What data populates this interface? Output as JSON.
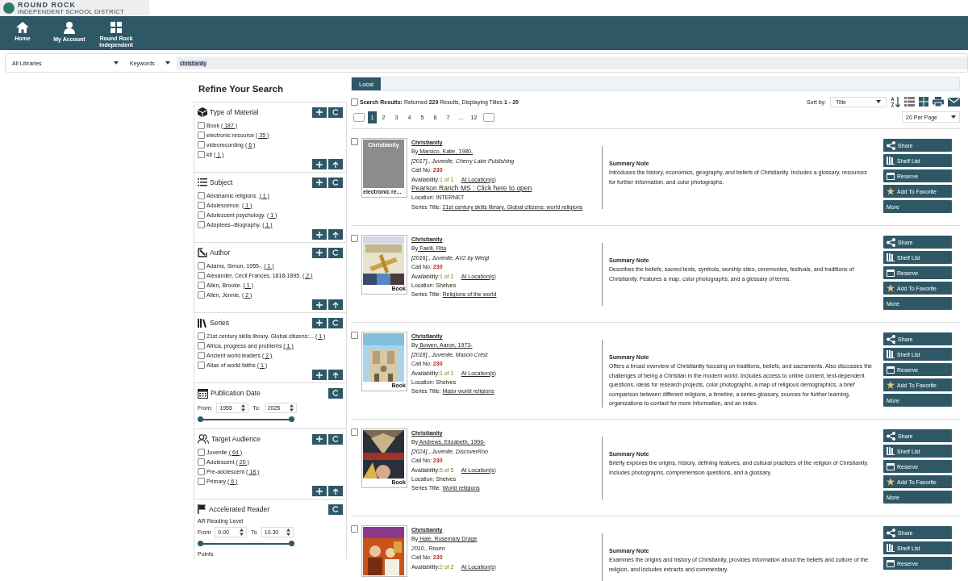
{
  "logo": {
    "name": "ROUND ROCK",
    "subtitle": "INDEPENDENT SCHOOL DISTRICT"
  },
  "nav": [
    {
      "kind": "home",
      "label": "Home"
    },
    {
      "kind": "account",
      "label": "My Account"
    },
    {
      "kind": "apps",
      "label": "Round Rock Independent"
    }
  ],
  "search": {
    "library": "All Libraries",
    "field": "Keywords",
    "value": "christianity"
  },
  "refine_title": "Refine Your Search",
  "facets": [
    {
      "kind": "checklist",
      "title": "Type of Material",
      "items": [
        {
          "label": "Book",
          "count": "( 187 )",
          "checked": false
        },
        {
          "label": "electronic resource",
          "count": "( 35 )",
          "checked": false
        },
        {
          "label": "videorecording",
          "count": "( 6 )",
          "checked": false
        },
        {
          "label": "kit",
          "count": "( 1 )",
          "checked": false
        }
      ]
    },
    {
      "kind": "checklist",
      "title": "Subject",
      "items": [
        {
          "label": "Abrahamic religions.",
          "count": "( 1 )",
          "checked": false
        },
        {
          "label": "Adolescence.",
          "count": "( 1 )",
          "checked": false
        },
        {
          "label": "Adolescent psychology.",
          "count": "( 1 )",
          "checked": false
        },
        {
          "label": "Adoptees--Biography.",
          "count": "( 1 )",
          "checked": false
        }
      ]
    },
    {
      "kind": "checklist",
      "title": "Author",
      "items": [
        {
          "label": "Adams, Simon, 1955-,",
          "count": "( 1 )",
          "checked": false
        },
        {
          "label": "Alexander, Cecil Frances, 1818-1895.",
          "count": "( 2 )",
          "checked": false
        },
        {
          "label": "Allen, Brooke.",
          "count": "( 1 )",
          "checked": false
        },
        {
          "label": "Allen, Jennie,",
          "count": "( 2 )",
          "checked": false
        }
      ]
    },
    {
      "kind": "checklist",
      "title": "Series",
      "items": [
        {
          "label": "21st century skills library. Global citizens:...",
          "count": "( 1 )",
          "checked": false
        },
        {
          "label": "Africa, progress and problems",
          "count": "( 1 )",
          "checked": false
        },
        {
          "label": "Ancient world leaders",
          "count": "( 2 )",
          "checked": false
        },
        {
          "label": "Atlas of world faiths",
          "count": "( 1 )",
          "checked": false
        }
      ]
    },
    {
      "kind": "range",
      "title": "Publication Date",
      "from_label": "From:",
      "from": "1955",
      "to_label": "To:",
      "to": "2025"
    },
    {
      "kind": "checklist",
      "title": "Target Audience",
      "items": [
        {
          "label": "Juvenile",
          "count": "( 64 )",
          "checked": false
        },
        {
          "label": "Adolescent",
          "count": "( 20 )",
          "checked": false
        },
        {
          "label": "Pre-adolescent",
          "count": "( 18 )",
          "checked": false
        },
        {
          "label": "Primary",
          "count": "( 6 )",
          "checked": false
        }
      ]
    },
    {
      "kind": "range",
      "title": "Accelerated Reader",
      "subtitle": "AR Reading Level",
      "from_label": "From",
      "from": "0.00",
      "to_label": "To",
      "to": "10.30",
      "footer": "Points"
    }
  ],
  "tabs": [
    {
      "label": "Local",
      "selected": true
    }
  ],
  "results_summary": {
    "checked": false,
    "label": "Search Results:",
    "text": "Returned **229** Results, Displaying Titles **1 - 20**"
  },
  "sort": {
    "label": "Sort by:",
    "value": "Title"
  },
  "pages": [
    {
      "label": "1",
      "selected": true
    },
    {
      "label": "2",
      "selected": false
    },
    {
      "label": "3",
      "selected": false
    },
    {
      "label": "4",
      "selected": false
    },
    {
      "label": "5",
      "selected": false
    },
    {
      "label": "6",
      "selected": false
    },
    {
      "label": "7",
      "selected": false
    },
    {
      "label": "...",
      "selected": false
    },
    {
      "label": "12",
      "selected": false
    }
  ],
  "per_page": "20 Per Page",
  "results": [
    {
      "checked": false,
      "cover": {
        "kind": "placeholder",
        "text": "Christianity",
        "format": "electronic re..."
      },
      "title": "Christianity",
      "by": "By",
      "author": "Marsico, Katie, 1980-",
      "pub": "[2017]., Juvenile, Cherry Lake Publishing",
      "call_label": "Call No:",
      "call_no": "230",
      "avail_label": "Availability:",
      "availability": "1 of 1",
      "location_link": "At Location(s)",
      "open_link": "Pearson Ranch MS : Click here to open",
      "location": "Location: INTERNET",
      "series_label": "Series Title:",
      "series": "21st century skills library. Global citizens: world religions",
      "summary_title": "Summary Note",
      "summary": "Introduces the history, economics, geography, and beliefs of Christianity. Includes a glossary, resources for further information, and color photographs.",
      "actions": [
        {
          "kind": "share",
          "label": "Share"
        },
        {
          "kind": "shelf",
          "label": "Shelf List"
        },
        {
          "kind": "reserve",
          "label": "Reserve"
        },
        {
          "kind": "favorite",
          "label": "Add To Favorite"
        },
        {
          "kind": "more",
          "label": "More"
        }
      ]
    },
    {
      "checked": false,
      "cover": {
        "kind": "picture",
        "format": "Book"
      },
      "title": "Christianity",
      "by": "By",
      "author": "Faelli, Rita",
      "pub": "[2016]., Juvenile, AV2 by Weigl",
      "call_label": "Call No:",
      "call_no": "230",
      "avail_label": "Availability:",
      "availability": "1 of 1",
      "location_link": "At Location(s)",
      "location": "Location: Shelves",
      "series_label": "Series Title:",
      "series": "Religions of the world",
      "summary_title": "Summary Note",
      "summary": "Describes the beliefs, sacred texts, symbols, worship sites, ceremonies, festivals, and traditions of Christianity. Features a map, color photographs, and a glossary of terms.",
      "actions": [
        {
          "kind": "share",
          "label": "Share"
        },
        {
          "kind": "shelf",
          "label": "Shelf List"
        },
        {
          "kind": "reserve",
          "label": "Reserve"
        },
        {
          "kind": "favorite",
          "label": "Add To Favorite"
        },
        {
          "kind": "more",
          "label": "More"
        }
      ]
    },
    {
      "checked": false,
      "cover": {
        "kind": "picture",
        "format": "Book"
      },
      "title": "Christianity",
      "by": "By",
      "author": "Bowen, Aaron, 1973-",
      "pub": "[2018]., Juvenile, Mason Crest",
      "call_label": "Call No:",
      "call_no": "230",
      "avail_label": "Availability:",
      "availability": "1 of 1",
      "location_link": "At Location(s)",
      "location": "Location: Shelves",
      "series_label": "Series Title:",
      "series": "Major world religions",
      "summary_title": "Summary Note",
      "summary": "Offers a broad overview of Christianity focusing on traditions, beliefs, and sacraments. Also discusses the challenges of being a Christian in the modern world. Includes access to online content, text-dependent questions, ideas for research projects, color photographs, a map of religious demographics, a brief comparison between different religions, a timeline, a series glossary, sources for further learning, organizations to contact for more information, and an index.",
      "actions": [
        {
          "kind": "share",
          "label": "Share"
        },
        {
          "kind": "shelf",
          "label": "Shelf List"
        },
        {
          "kind": "reserve",
          "label": "Reserve"
        },
        {
          "kind": "favorite",
          "label": "Add To Favorite"
        },
        {
          "kind": "more",
          "label": "More"
        }
      ]
    },
    {
      "checked": false,
      "cover": {
        "kind": "picture",
        "format": "Book"
      },
      "title": "Christianity",
      "by": "By",
      "author": "Andrews, Elizabeth, 1996-",
      "pub": "[2024]., Juvenile, DiscoverRoo",
      "call_label": "Call No:",
      "call_no": "230",
      "avail_label": "Availability:",
      "availability": "5 of 5",
      "location_link": "At Location(s)",
      "location": "Location: Shelves",
      "series_label": "Series Title:",
      "series": "World religions",
      "summary_title": "Summary Note",
      "summary": "Briefly explores the origins, history, defining features, and cultural practices of the religion of Christianity. Includes photographs, comprehension questions, and a glossary.",
      "actions": [
        {
          "kind": "share",
          "label": "Share"
        },
        {
          "kind": "shelf",
          "label": "Shelf List"
        },
        {
          "kind": "reserve",
          "label": "Reserve"
        },
        {
          "kind": "favorite",
          "label": "Add To Favorite"
        },
        {
          "kind": "more",
          "label": "More"
        }
      ]
    },
    {
      "checked": false,
      "cover": {
        "kind": "picture"
      },
      "title": "Christianity",
      "by": "By",
      "author": "Hale, Rosemary Drage",
      "pub": "2010., Rosen",
      "call_label": "Call No:",
      "call_no": "230",
      "avail_label": "Availability:",
      "availability": "2 of 2",
      "location_link": "At Location(s)",
      "summary_title": "Summary Note",
      "summary": "Examines the origins and history of Christianity, provides information about the beliefs and culture of the religion, and includes extracts and commentary.",
      "actions": [
        {
          "kind": "share",
          "label": "Share"
        },
        {
          "kind": "shelf",
          "label": "Shelf List"
        },
        {
          "kind": "reserve",
          "label": "Reserve"
        }
      ]
    }
  ]
}
